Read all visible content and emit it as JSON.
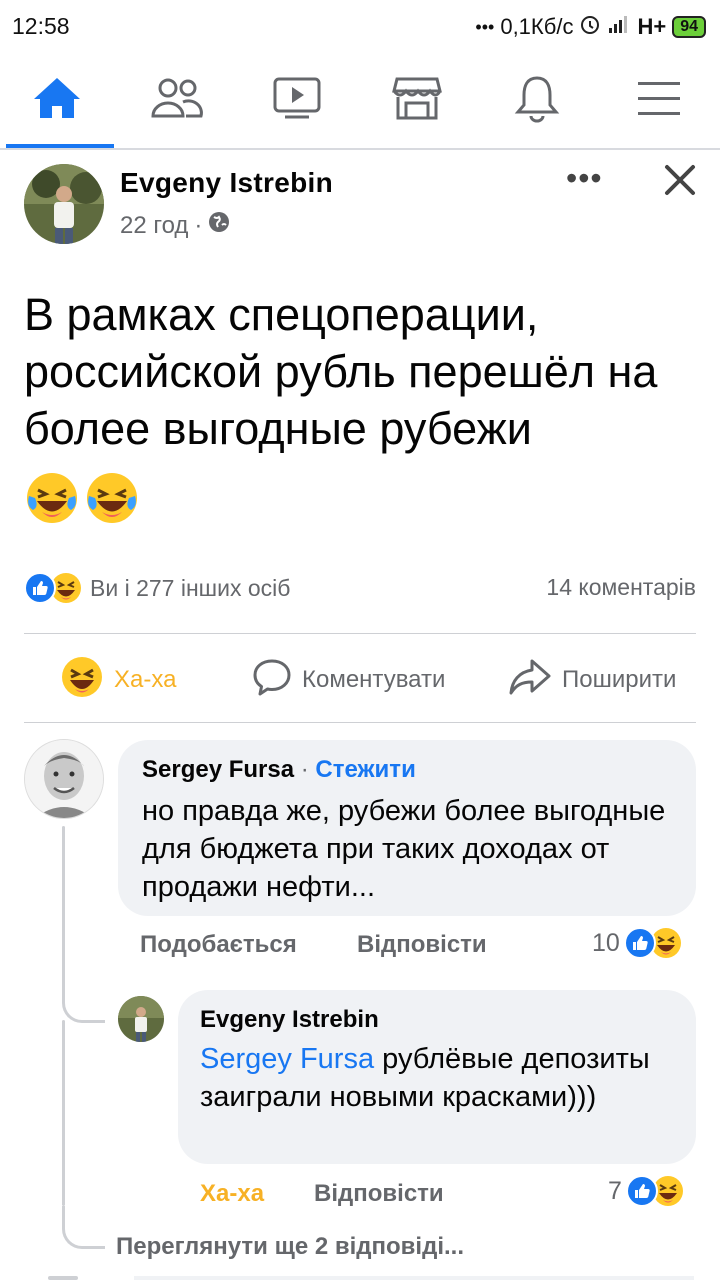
{
  "status_bar": {
    "time": "12:58",
    "dots": "•••",
    "network_speed": "0,1Кб/с",
    "network_type": "H+",
    "battery": "94"
  },
  "nav": {
    "items": [
      "home-icon",
      "friends-icon",
      "watch-icon",
      "marketplace-icon",
      "notifications-icon",
      "menu-icon"
    ],
    "active_index": 0,
    "accent_color": "#1877f2"
  },
  "post": {
    "author": "Evgeny  Istrebin",
    "time": "22 год",
    "time_separator": "·",
    "privacy_icon": "globe-icon",
    "text": "В рамках спецоперации, российской рубль перешёл на более выгодные рубежи",
    "emojis": [
      "laughing-with-tears-emoji",
      "laughing-with-tears-emoji"
    ],
    "reactions_summary": "Ви і 277 інших осіб",
    "comments_count": "14 коментарів",
    "actions": {
      "haha": "Ха-ха",
      "comment": "Коментувати",
      "share": "Поширити"
    }
  },
  "comments": [
    {
      "author": "Sergey Fursa",
      "separator": "·",
      "follow": "Стежити",
      "text": "но правда же, рубежи более выгодные для бюджета при таких доходах от продажи нефти...",
      "like_label": "Подобається",
      "reply_label": "Відповісти",
      "reaction_count": "10"
    },
    {
      "author": "Evgeny  Istrebin",
      "mention": "Sergey Fursa",
      "text": " рублёвые депозиты заиграли новыми красками)))",
      "like_label": "Ха-ха",
      "reply_label": "Відповісти",
      "reaction_count": "7"
    }
  ],
  "view_more_replies": "Переглянути ще 2 відповіді..."
}
